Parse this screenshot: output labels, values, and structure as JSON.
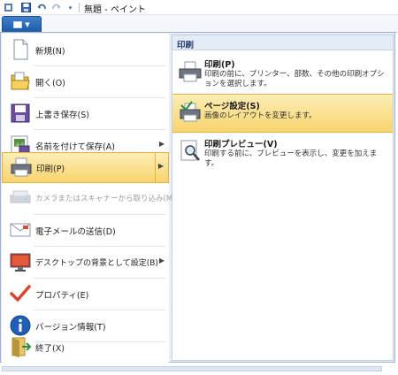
{
  "title": "無題 - ペイント",
  "quick_access": [
    "save-icon",
    "undo-icon",
    "redo-icon",
    "customize-dropdown-icon"
  ],
  "menu_button_icon": "paint-menu-icon",
  "left_menu": [
    {
      "label": "新規(N)",
      "icon": "new-document-icon",
      "has_submenu": false
    },
    {
      "label": "開く(O)",
      "icon": "open-folder-icon",
      "has_submenu": false
    },
    {
      "label": "上書き保存(S)",
      "icon": "save-disk-icon",
      "has_submenu": false
    },
    {
      "label": "名前を付けて保存(A)",
      "icon": "save-as-icon",
      "has_submenu": true
    },
    {
      "label": "印刷(P)",
      "icon": "printer-icon",
      "has_submenu": true,
      "selected": true
    },
    {
      "label": "カメラまたはスキャナーから取り込み(M)",
      "icon": "scanner-icon",
      "has_submenu": false,
      "disabled": true
    },
    {
      "label": "電子メールの送信(D)",
      "icon": "email-icon",
      "has_submenu": false
    },
    {
      "label": "デスクトップの背景として設定(B)",
      "icon": "desktop-background-icon",
      "has_submenu": true
    },
    {
      "label": "プロパティ(E)",
      "icon": "checkmark-icon",
      "has_submenu": false
    },
    {
      "label": "バージョン情報(T)",
      "icon": "info-icon",
      "has_submenu": false
    },
    {
      "label": "終了(X)",
      "icon": "exit-icon",
      "has_submenu": false
    }
  ],
  "submenu": {
    "header": "印刷",
    "items": [
      {
        "title": "印刷(P)",
        "description": "印刷の前に、プリンター、部数、その他の印刷オプションを選択します。",
        "icon": "printer-icon"
      },
      {
        "title": "ページ設定(S)",
        "description": "画像のレイアウトを変更します。",
        "icon": "page-setup-icon",
        "highlighted": true
      },
      {
        "title": "印刷プレビュー(V)",
        "description": "印刷する前に、プレビューを表示し、変更を加えます。",
        "icon": "print-preview-icon"
      }
    ]
  },
  "colors": {
    "accent_blue": "#1c5aa6",
    "hover_gold": "#f8d46e",
    "header_bg": "#e4ecf7"
  }
}
